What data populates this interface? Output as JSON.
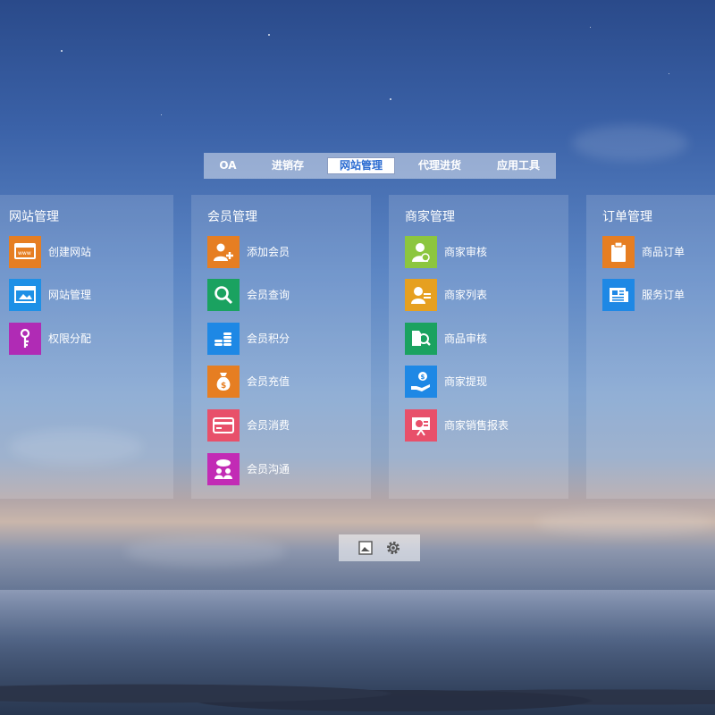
{
  "nav": {
    "tabs": [
      {
        "label": "OA"
      },
      {
        "label": "进销存"
      },
      {
        "label": "网站管理",
        "active": true
      },
      {
        "label": "代理进货"
      },
      {
        "label": "应用工具"
      }
    ]
  },
  "panels": [
    {
      "title": "网站管理",
      "items": [
        {
          "label": "创建网站",
          "icon": "www-browser-icon",
          "color": "#e67e22"
        },
        {
          "label": "网站管理",
          "icon": "browser-window-icon",
          "color": "#1e90e6"
        },
        {
          "label": "权限分配",
          "icon": "key-icon",
          "color": "#b02bb5"
        }
      ]
    },
    {
      "title": "会员管理",
      "items": [
        {
          "label": "添加会员",
          "icon": "add-user-icon",
          "color": "#e67e22"
        },
        {
          "label": "会员查询",
          "icon": "search-icon",
          "color": "#1aa260"
        },
        {
          "label": "会员积分",
          "icon": "coins-stack-icon",
          "color": "#1e88e5"
        },
        {
          "label": "会员充值",
          "icon": "money-bag-icon",
          "color": "#e67e22"
        },
        {
          "label": "会员消费",
          "icon": "credit-card-icon",
          "color": "#e8506a"
        },
        {
          "label": "会员沟通",
          "icon": "chat-people-icon",
          "color": "#c22bb5"
        }
      ]
    },
    {
      "title": "商家管理",
      "items": [
        {
          "label": "商家审核",
          "icon": "user-verify-icon",
          "color": "#8cc63f"
        },
        {
          "label": "商家列表",
          "icon": "user-card-icon",
          "color": "#e6a020"
        },
        {
          "label": "商品审核",
          "icon": "product-search-icon",
          "color": "#1aa260"
        },
        {
          "label": "商家提现",
          "icon": "hand-money-icon",
          "color": "#1e88e5"
        },
        {
          "label": "商家销售报表",
          "icon": "report-board-icon",
          "color": "#e8506a"
        }
      ]
    },
    {
      "title": "订单管理",
      "items": [
        {
          "label": "商品订单",
          "icon": "clipboard-icon",
          "color": "#e67e22"
        },
        {
          "label": "服务订单",
          "icon": "newspaper-icon",
          "color": "#1e88e5"
        }
      ]
    }
  ],
  "bottom": {
    "buttons": [
      {
        "icon": "wallpaper-icon"
      },
      {
        "icon": "gear-icon"
      }
    ]
  }
}
